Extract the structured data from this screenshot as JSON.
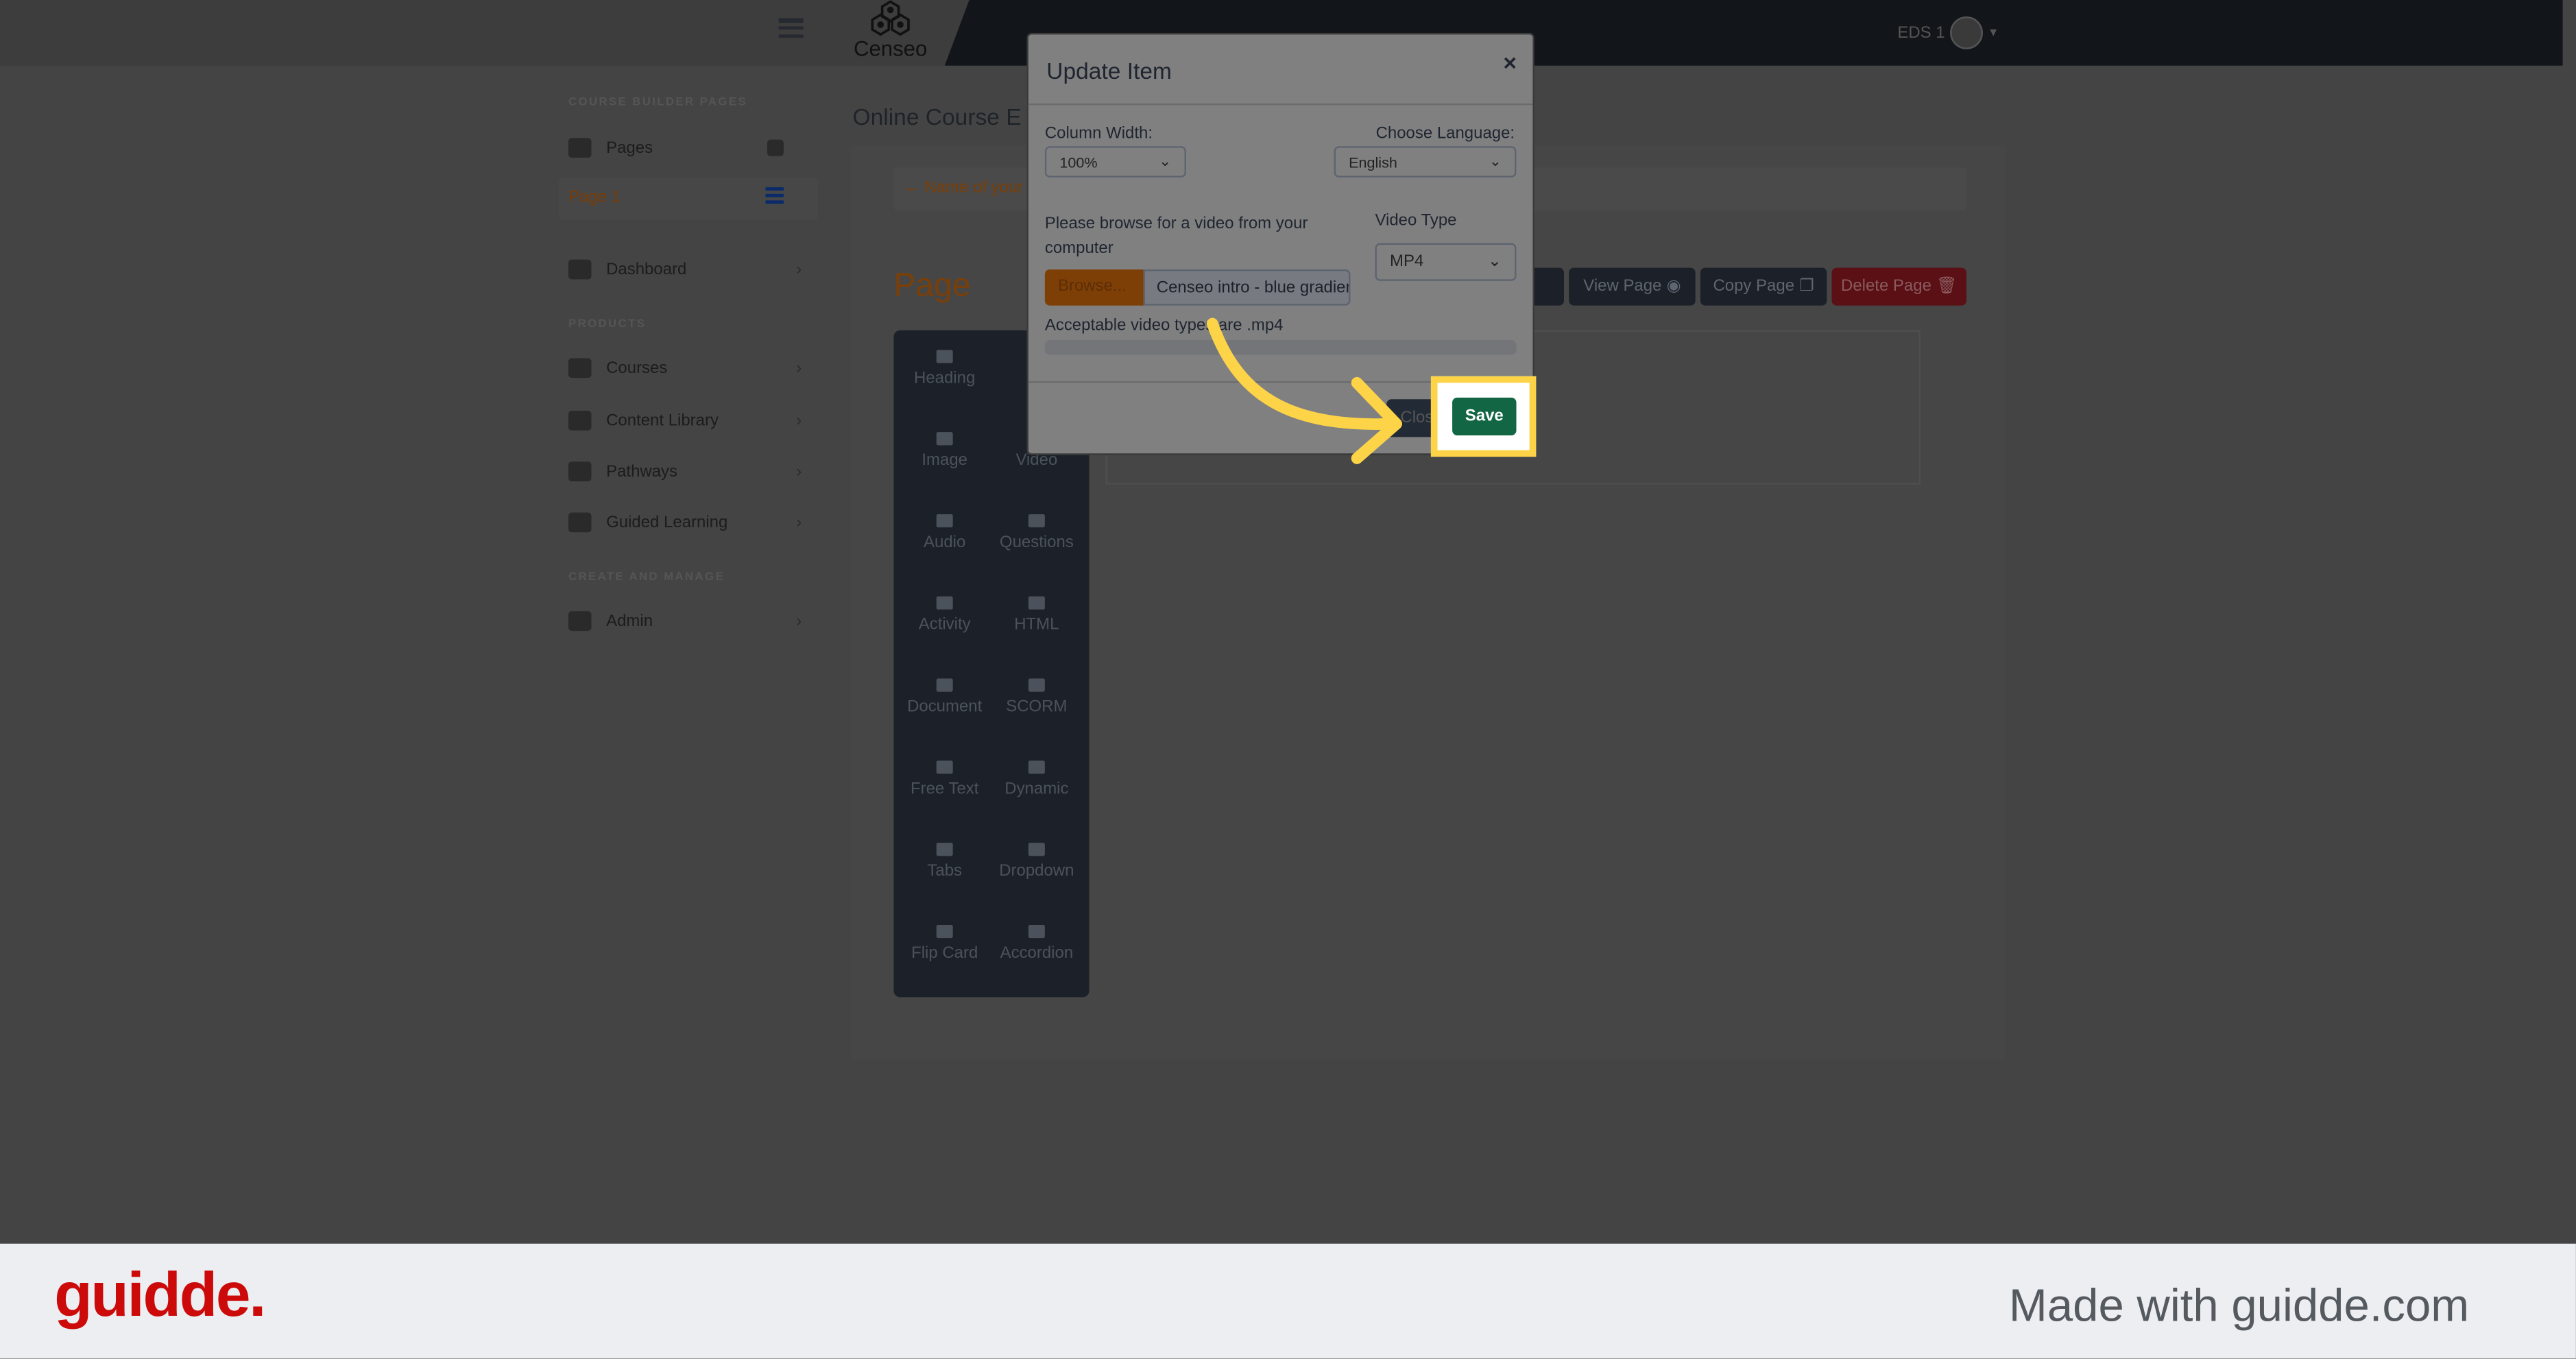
{
  "header": {
    "brand": "Censeo",
    "user": "EDS 1"
  },
  "sidebar": {
    "section1": "COURSE BUILDER PAGES",
    "pages": "Pages",
    "page1": "Page 1",
    "dashboard": "Dashboard",
    "section2": "PRODUCTS",
    "items": [
      "Courses",
      "Content Library",
      "Pathways",
      "Guided Learning"
    ],
    "section3": "CREATE AND MANAGE",
    "admin": "Admin"
  },
  "main": {
    "title": "Online Course E",
    "breadcrumb": "Name of your",
    "page_title": "Page",
    "buttons": {
      "view": "View Page",
      "copy": "Copy Page",
      "delete": "Delete Page"
    },
    "tools": [
      "Heading",
      "Image",
      "Video",
      "Audio",
      "Questions",
      "Activity",
      "HTML",
      "Document",
      "SCORM",
      "Free Text",
      "Dynamic",
      "Tabs",
      "Dropdown",
      "Flip Card",
      "Accordion"
    ]
  },
  "modal": {
    "title": "Update Item",
    "close_x": "×",
    "column_width_label": "Column Width:",
    "column_width": "100%",
    "language_label": "Choose Language:",
    "language": "English",
    "browse_label": "Please browse for a video from your computer",
    "video_type_label": "Video Type",
    "video_type": "MP4",
    "browse_button": "Browse...",
    "file_name": "Censeo intro - blue gradient",
    "acceptable": "Acceptable video types are .mp4",
    "close_button": "Close",
    "save_button": "Save"
  },
  "colors": {
    "accent": "#fdd348",
    "save": "#136644",
    "browse": "#e07b10",
    "delete": "#c8202b"
  },
  "footer": {
    "logo": "guidde.",
    "made_with": "Made with guidde.com"
  }
}
